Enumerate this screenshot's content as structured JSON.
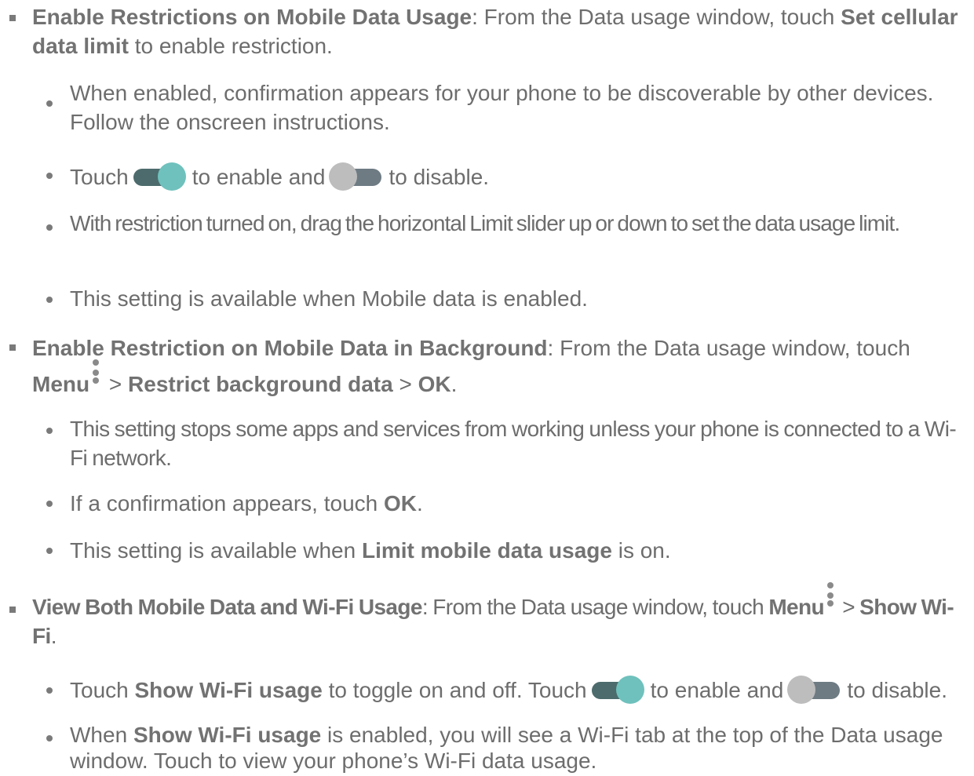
{
  "items": [
    {
      "title": "Enable Restrictions on Mobile Data Usage",
      "lead": ": From the Data usage window, touch ",
      "bold1": "Set cellular data limit",
      "tail": " to enable restriction."
    },
    {
      "text": "When enabled, confirmation appears for your phone to be discoverable by other devices. Follow the onscreen instructions."
    },
    {
      "pre": "Touch",
      "mid": "to enable and",
      "post": "to disable."
    },
    {
      "text": "With restriction turned on, drag the horizontal Limit slider up or down to set the data usage limit."
    },
    {
      "text": "This setting is available when Mobile data is enabled."
    },
    {
      "title": "Enable Restriction on Mobile Data in Background",
      "lead": ": From the Data usage window, touch",
      "menu": "Menu",
      "gt1": " > ",
      "b2": "Restrict background data",
      "gt2": " > ",
      "b3": "OK",
      "end": "."
    },
    {
      "text": "This setting stops some apps and services from working unless your phone is connected to a Wi-Fi network."
    },
    {
      "pre": "If a confirmation appears, touch ",
      "bold": "OK",
      "post": "."
    },
    {
      "pre": "This setting is available when ",
      "bold": "Limit mobile data usage",
      "post": " is on."
    },
    {
      "title": "View Both Mobile Data and Wi-Fi Usage",
      "lead": ": From the Data usage window, touch ",
      "menu": "Menu",
      "gt1": " > ",
      "b2": "Show Wi-Fi",
      "end": "."
    },
    {
      "pre": "Touch ",
      "bold": "Show Wi-Fi usage",
      "mid": " to toggle on and off. Touch",
      "mid2": "to enable and",
      "post": "to disable."
    },
    {
      "pre": "When ",
      "bold": "Show Wi-Fi usage",
      "post": " is enabled, you will see a Wi-Fi tab at the top of the Data usage window. Touch to view your phone’s Wi-Fi data usage."
    }
  ],
  "icons": {
    "toggle_on": "toggle-on-icon",
    "toggle_off": "toggle-off-icon",
    "menu": "menu-kebab-icon"
  },
  "colors": {
    "text": "#6d6d6d",
    "toggle_on_track": "#4d6b6c",
    "toggle_on_knob": "#6fc1bd",
    "toggle_off_track": "#6e7b83",
    "toggle_off_knob": "#bdbdbd"
  }
}
